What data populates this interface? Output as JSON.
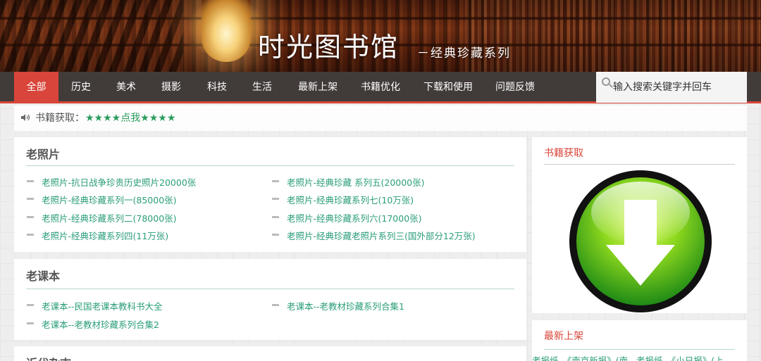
{
  "banner": {
    "title": "时光图书馆",
    "subtitle": "－经典珍藏系列"
  },
  "nav": {
    "items": [
      {
        "label": "全部",
        "active": true
      },
      {
        "label": "历史"
      },
      {
        "label": "美术"
      },
      {
        "label": "摄影"
      },
      {
        "label": "科技"
      },
      {
        "label": "生活"
      },
      {
        "label": "最新上架"
      },
      {
        "label": "书籍优化"
      },
      {
        "label": "下载和使用"
      },
      {
        "label": "问题反馈"
      }
    ],
    "search_placeholder": "输入搜索关键字并回车"
  },
  "notice": {
    "icon": "speaker-icon",
    "label": "书籍获取：",
    "link": "★★★★点我★★★★"
  },
  "sections": [
    {
      "title": "老照片",
      "left": [
        "老照片-抗日战争珍贵历史照片20000张",
        "老照片-经典珍藏系列一(85000张)",
        "老照片-经典珍藏系列二(78000张)",
        "老照片-经典珍藏系列四(11万张)"
      ],
      "right": [
        "老照片-经典珍藏 系列五(20000张)",
        "老照片-经典珍藏系列七(10万张)",
        "老照片-经典珍藏系列六(17000张)",
        "老照片-经典珍藏老照片系列三(国外部分12万张)"
      ]
    },
    {
      "title": "老课本",
      "left": [
        "老课本--民国老课本教科书大全",
        "老课本--老教材珍藏系列合集2"
      ],
      "right": [
        "老课本--老教材珍藏系列合集1"
      ]
    },
    {
      "title": "近代杂志"
    }
  ],
  "sidebar": {
    "download_title": "书籍获取",
    "download_icon": "download-arrow-icon",
    "latest_title": "最新上架",
    "latest_left": "老报纸–《南京新报》(南…",
    "latest_right": "老报纸–《小日报》(上…"
  },
  "colors": {
    "accent": "#d9453a",
    "link": "#2a9d7a",
    "nav_bg": "#2d2826"
  }
}
